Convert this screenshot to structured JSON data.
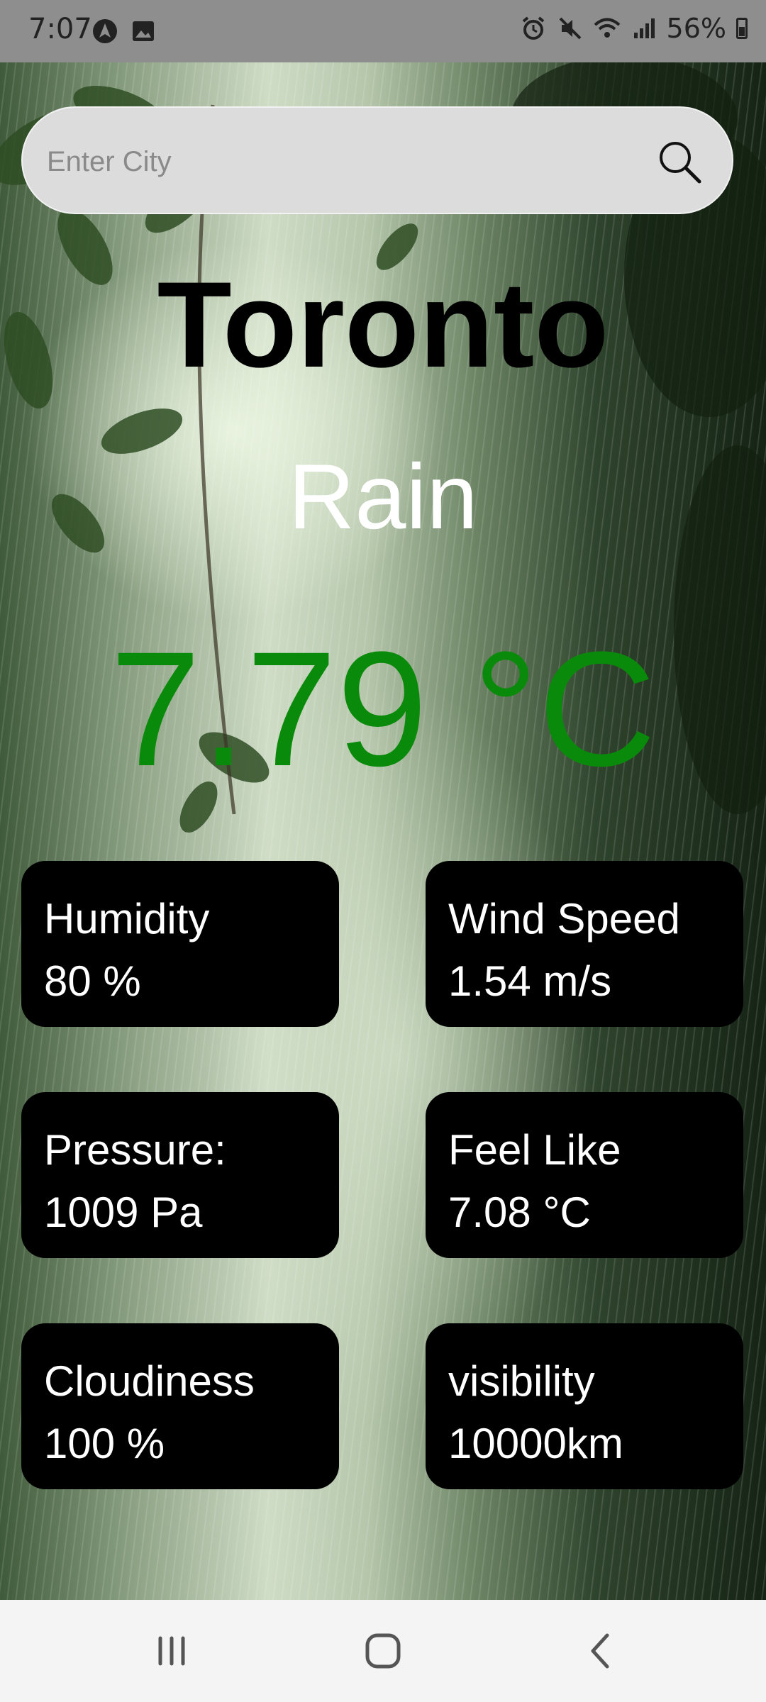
{
  "status_bar": {
    "time": "7:07",
    "battery": "56%",
    "icons": [
      "navigation-app-icon",
      "gallery-icon",
      "alarm-icon",
      "mute-icon",
      "wifi-icon",
      "signal-icon",
      "battery-icon"
    ]
  },
  "search": {
    "placeholder": "Enter City",
    "value": "",
    "icon": "search-icon"
  },
  "weather": {
    "city": "Toronto",
    "condition": "Rain",
    "temperature": "7.79 °C"
  },
  "details": [
    {
      "label": "Humidity",
      "value": "80 %"
    },
    {
      "label": "Wind Speed",
      "value": "1.54 m/s"
    },
    {
      "label": "Pressure:",
      "value": "1009 Pa"
    },
    {
      "label": "Feel Like",
      "value": "7.08 °C"
    },
    {
      "label": "Cloudiness",
      "value": "100 %"
    },
    {
      "label": "visibility",
      "value": "10000km"
    }
  ],
  "colors": {
    "temperature": "#0a8a0a",
    "condition": "#ffffff",
    "card_background": "#000000",
    "search_background": "#dcdcdc"
  },
  "nav_bar": {
    "icons": [
      "recent-apps-icon",
      "home-icon",
      "back-icon"
    ]
  }
}
